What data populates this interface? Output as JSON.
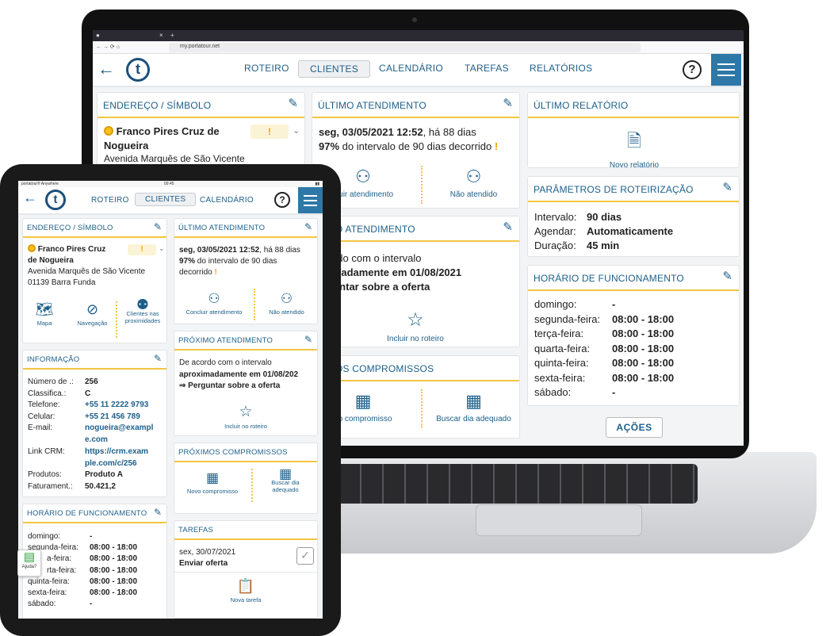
{
  "browser": {
    "url": "my.portatour.net",
    "tab_close": "×",
    "tab_new": "+"
  },
  "nav": {
    "tabs": [
      "ROTEIRO",
      "CLIENTES",
      "CALENDÁRIO",
      "TAREFAS",
      "RELATÓRIOS"
    ],
    "active": "CLIENTES",
    "help": "?",
    "logo": "t"
  },
  "address_card": {
    "title": "ENDEREÇO / SÍMBOLO",
    "customer_name_1": "Franco Pires Cruz de",
    "customer_name_2": "Nogueira",
    "tablet_name_1": "Franco Pires Cruz",
    "tablet_name_2": "de Nogueira",
    "street": "Avenida Marquês de São Vicente",
    "city": "01139 Barra Funda",
    "badge": "!",
    "actions": [
      "Mapa",
      "Navegação",
      "Clientes nas proximidades"
    ]
  },
  "last_visit": {
    "title": "ÚLTIMO ATENDIMENTO",
    "date": "seg, 03/05/2021 12:52",
    "ago": ", há 88 dias",
    "pct": "97%",
    "interval_text": " do intervalo de 90 dias decorrido",
    "interval_a": " do intervalo de 90 dias",
    "interval_b": "decorrido",
    "excl": "!",
    "laptop_action_1": "cluir atendimento",
    "action_1": "Concluir atendimento",
    "action_2": "Não atendido"
  },
  "next_visit": {
    "title": "PRÓXIMO ATENDIMENTO",
    "laptop_title": "XIMO ATENDIMENTO",
    "line1": "De acordo com o intervalo",
    "laptop_line1": "acordo com o intervalo",
    "line2": "aproximadamente em 01/08/202",
    "laptop_line2": "oximadamente em 01/08/2021",
    "line3": "⇒ Perguntar sobre a oferta",
    "laptop_line3": "erguntar sobre a oferta",
    "action": "Incluir no roteiro"
  },
  "appointments": {
    "title": "PRÓXIMOS COMPROMISSOS",
    "laptop_title": "XIMOS COMPROMISSOS",
    "action_1": "Novo compromisso",
    "laptop_action_1": "vo compromisso",
    "action_2": "Buscar dia adequado",
    "tablet_action_2a": "Buscar dia",
    "tablet_action_2b": "adequado"
  },
  "last_report": {
    "title": "ÚLTIMO RELATÓRIO",
    "action": "Novo relatório"
  },
  "routing_params": {
    "title": "PARÂMETROS DE ROTEIRIZAÇÃO",
    "rows": [
      {
        "label": "Intervalo:",
        "value": "90 dias"
      },
      {
        "label": "Agendar:",
        "value": "Automaticamente"
      },
      {
        "label": "Duração:",
        "value": "45 min"
      }
    ]
  },
  "opening_hours": {
    "title": "HORÁRIO DE FUNCIONAMENTO",
    "rows": [
      {
        "day": "domingo:",
        "hours": "-"
      },
      {
        "day": "segunda-feira:",
        "hours": "08:00 - 18:00"
      },
      {
        "day": "terça-feira:",
        "hours": "08:00 - 18:00"
      },
      {
        "day": "quarta-feira:",
        "hours": "08:00 - 18:00"
      },
      {
        "day": "quinta-feira:",
        "hours": "08:00 - 18:00"
      },
      {
        "day": "sexta-feira:",
        "hours": "08:00 - 18:00"
      },
      {
        "day": "sábado:",
        "hours": "-"
      }
    ],
    "tablet_partial_days": [
      "domingo:",
      "segunda-feira:",
      "a-feira:",
      "rta-feira:",
      "quinta-feira:",
      "sexta-feira:",
      "sábado:"
    ]
  },
  "actions_button": "AÇÕES",
  "info": {
    "title": "INFORMAÇÃO",
    "rows": [
      {
        "label": "Número de .:",
        "value": "256"
      },
      {
        "label": "Classifica.:",
        "value": "C"
      },
      {
        "label": "Telefone:",
        "value": "+55 11 2222 9793"
      },
      {
        "label": "Celular:",
        "value": "+55 21 456 789"
      },
      {
        "label": "E-mail:",
        "value": "nogueira@example.com"
      },
      {
        "label": "Link CRM:",
        "value": "https://crm.example.com/c/256"
      },
      {
        "label": "Produtos:",
        "value": "Produto A"
      },
      {
        "label": "Faturament.:",
        "value": "50.421,2"
      }
    ],
    "email_a": "nogueira@exampl",
    "email_b": "e.com",
    "crm_a": "https://crm.exam",
    "crm_b": "ple.com/c/256"
  },
  "tasks": {
    "title": "TAREFAS",
    "date": "sex, 30/07/2021",
    "task": "Enviar oferta",
    "action": "Nova tarefa"
  },
  "tablet_status": {
    "left": "portatour® Anywhere",
    "center": "09:45"
  },
  "ajuda": "Ajuda?",
  "colors": {
    "primary": "#1d5f8a",
    "accent": "#f4c542",
    "warning": "#f0a500",
    "menu": "#2e78a8"
  },
  "icons": [
    "back-arrow-icon",
    "pencil-icon",
    "map-icon",
    "compass-icon",
    "people-icon",
    "person-check-icon",
    "person-question-icon",
    "star-plus-icon",
    "calendar-plus-icon",
    "calendar-search-icon",
    "report-plus-icon",
    "clipboard-plus-icon",
    "checkbox-icon",
    "chat-icon"
  ]
}
